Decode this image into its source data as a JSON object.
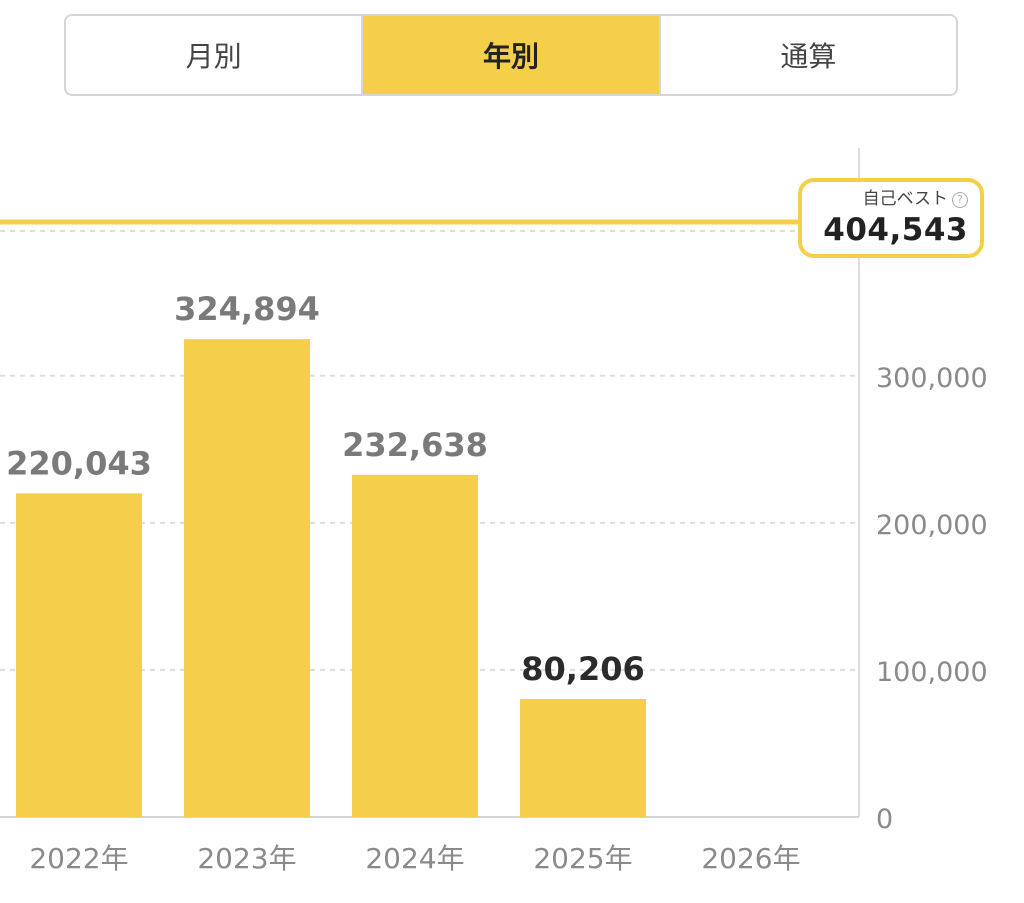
{
  "tabs": [
    {
      "label": "月別",
      "active": false
    },
    {
      "label": "年別",
      "active": true
    },
    {
      "label": "通算",
      "active": false
    }
  ],
  "best": {
    "label": "自己ベスト",
    "value_text": "404,543",
    "help_icon": "question-circle-icon"
  },
  "colors": {
    "bar": "#f5cf4a",
    "accent": "#f5cf4a",
    "label_past": "#7a7a7a",
    "label_current": "#2b2b2b",
    "axis_text": "#8a8a8a"
  },
  "chart_data": {
    "type": "bar",
    "categories": [
      "2022年",
      "2023年",
      "2024年",
      "2025年",
      "2026年"
    ],
    "values": [
      220043,
      324894,
      232638,
      80206,
      null
    ],
    "value_labels": [
      "220,043",
      "324,894",
      "232,638",
      "80,206",
      ""
    ],
    "highlighted_index": 3,
    "ylim": [
      0,
      404543
    ],
    "yticks": [
      0,
      100000,
      200000,
      300000
    ],
    "ytick_labels": [
      "0",
      "100,000",
      "200,000",
      "300,000"
    ],
    "reference_line": {
      "label": "自己ベスト",
      "value": 404543
    },
    "grid": true,
    "xlabel": "",
    "ylabel": "",
    "title": ""
  }
}
